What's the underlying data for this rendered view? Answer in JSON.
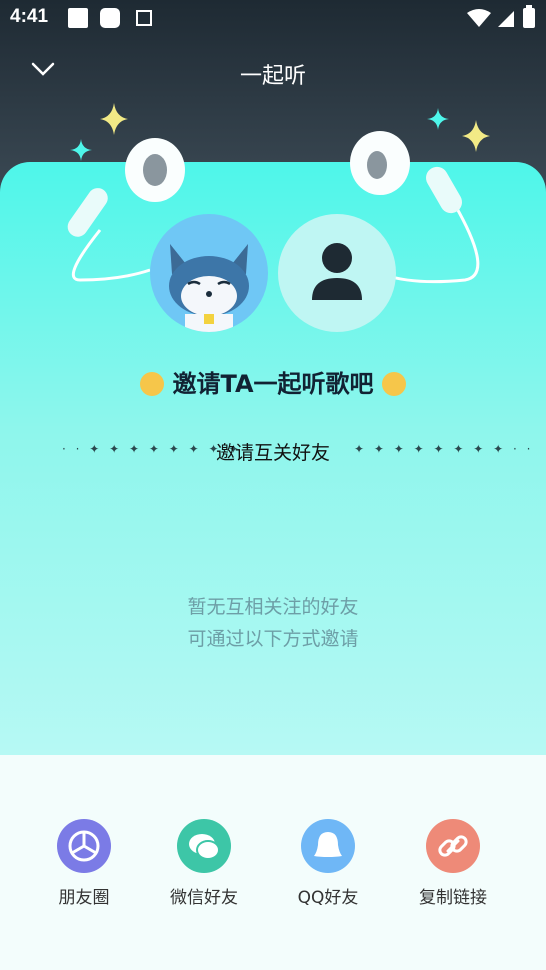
{
  "status_bar": {
    "time": "4:41"
  },
  "header": {
    "title": "一起听"
  },
  "invite": {
    "title": "邀请TA一起听歌吧",
    "subtitle": "邀请互关好友"
  },
  "empty_state": {
    "line1": "暂无互相关注的好友",
    "line2": "可通过以下方式邀请"
  },
  "share": {
    "items": [
      {
        "label": "朋友圈",
        "icon": "moments-icon",
        "color": "#7b7be6"
      },
      {
        "label": "微信好友",
        "icon": "wechat-icon",
        "color": "#3dc6a7"
      },
      {
        "label": "QQ好友",
        "icon": "qq-icon",
        "color": "#6fb7f6"
      },
      {
        "label": "复制链接",
        "icon": "link-icon",
        "color": "#ee8a78"
      }
    ]
  }
}
